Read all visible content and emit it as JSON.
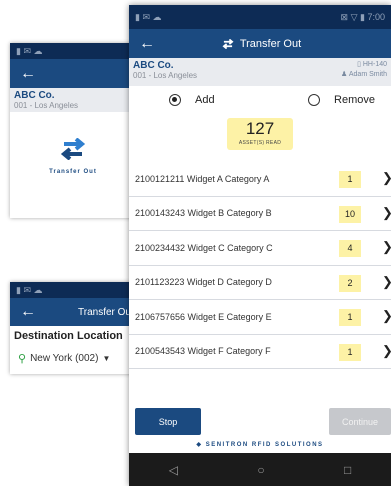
{
  "customer": {
    "name": "ABC Co.",
    "location": "001 - Los Angeles"
  },
  "screen1": {
    "tile_label": "Transfer Out"
  },
  "screen2": {
    "title": "Transfer Out",
    "destination_label": "Destination Location",
    "destination_value": "New York (002)"
  },
  "main": {
    "time": "7:00",
    "title": "Transfer Out",
    "device": "HH-140",
    "user": "Adam Smith",
    "mode_add": "Add",
    "mode_remove": "Remove",
    "selected_mode": "add",
    "count": "127",
    "count_label": "ASSET(S) READ",
    "items": [
      {
        "label": "2100121211  Widget A  Category A",
        "qty": "1"
      },
      {
        "label": "2100143243  Widget B  Category B",
        "qty": "10"
      },
      {
        "label": "2100234432  Widget C  Category C",
        "qty": "4"
      },
      {
        "label": "2101123223  Widget D  Category D",
        "qty": "2"
      },
      {
        "label": "2106757656  Widget E  Category E",
        "qty": "1"
      },
      {
        "label": "2100543543  Widget F  Category F",
        "qty": "1"
      }
    ],
    "stop_label": "Stop",
    "continue_label": "Continue",
    "footer": "SENITRON RFID SOLUTIONS"
  },
  "icons": {
    "back": "arrow-left-icon",
    "transfer": "transfer-arrows-icon",
    "location": "map-pin-icon",
    "chevron": "chevron-right-icon"
  },
  "colors": {
    "brand": "#1b4a80",
    "status_bar": "#0d2b55",
    "highlight": "#fdf2a6",
    "pin": "#2ea043"
  }
}
